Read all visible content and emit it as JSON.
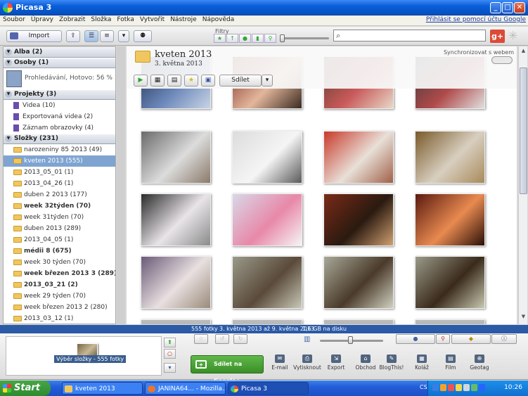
{
  "window": {
    "title": "Picasa 3"
  },
  "menu": {
    "items": [
      "Soubor",
      "Úpravy",
      "Zobrazit",
      "Složka",
      "Fotka",
      "Vytvořit",
      "Nástroje",
      "Nápověda"
    ],
    "signin": "Přihlásit se pomocí účtu Google"
  },
  "toolbar": {
    "import_label": "Import",
    "filters_label": "Filtry"
  },
  "left": {
    "albums_header": "Alba (2)",
    "people_header": "Osoby (1)",
    "people_status": "Prohledávání, Hotovo: 56 %",
    "projects_header": "Projekty (3)",
    "projects": [
      "Videa (10)",
      "Exportovaná videa (2)",
      "Záznam obrazovky (4)"
    ],
    "folders_header": "Složky (231)",
    "folders": [
      {
        "label": "narozeniny 85 2013 (49)",
        "bold": false,
        "selected": false
      },
      {
        "label": "kveten 2013 (555)",
        "bold": false,
        "selected": true
      },
      {
        "label": "2013_05_01 (1)",
        "bold": false,
        "selected": false
      },
      {
        "label": "2013_04_26 (1)",
        "bold": false,
        "selected": false
      },
      {
        "label": "duben 2 2013 (177)",
        "bold": false,
        "selected": false
      },
      {
        "label": "week 32týden (70)",
        "bold": true,
        "selected": false
      },
      {
        "label": "week 31týden (70)",
        "bold": false,
        "selected": false
      },
      {
        "label": "duben 2013 (289)",
        "bold": false,
        "selected": false
      },
      {
        "label": "2013_04_05 (1)",
        "bold": false,
        "selected": false
      },
      {
        "label": "médii 8 (675)",
        "bold": true,
        "selected": false
      },
      {
        "label": "week 30 týden (70)",
        "bold": false,
        "selected": false
      },
      {
        "label": "week březen 2013 3 (289)",
        "bold": true,
        "selected": false
      },
      {
        "label": "2013_03_21 (2)",
        "bold": true,
        "selected": false
      },
      {
        "label": "week 29 týden (70)",
        "bold": false,
        "selected": false
      },
      {
        "label": "week březen 2013 2 (280)",
        "bold": false,
        "selected": false
      },
      {
        "label": "2013_03_12 (1)",
        "bold": false,
        "selected": false
      }
    ]
  },
  "main": {
    "folder_title": "kveten 2013",
    "folder_date": "3. května 2013",
    "sync_label": "Synchronizovat s webem",
    "share_label": "Sdílet"
  },
  "status": {
    "count": "555 fotky",
    "range": "3. května 2013 až 9. května 2013",
    "size": "1,6 GB na disku"
  },
  "tray": {
    "selection_label": "Výběr složky - 555 fotky"
  },
  "bottom": {
    "share_google": "Sdílet na Google+",
    "actions": [
      "E-mail",
      "Vytisknout",
      "Export",
      "Obchod",
      "BlogThis!",
      "Koláž",
      "Film",
      "Geotag"
    ]
  },
  "taskbar": {
    "start": "Start",
    "tasks": [
      "kveten 2013",
      "JANINA64... - Mozilla...",
      "Picasa 3"
    ],
    "lang": "CS",
    "clock": "10:26"
  },
  "colors": {
    "selection": "#7fa4d1",
    "statusbar": "#2b5aa6",
    "share_green": "#4aa336"
  }
}
